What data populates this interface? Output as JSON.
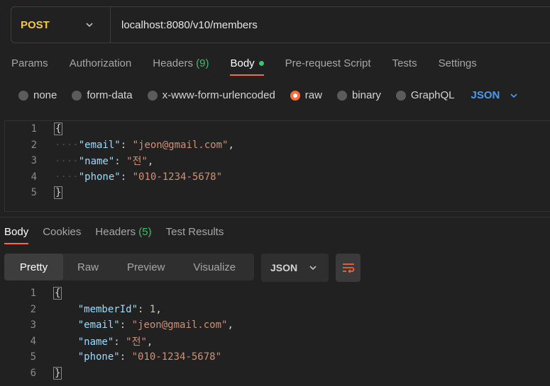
{
  "request": {
    "method": "POST",
    "url": "localhost:8080/v10/members"
  },
  "request_tabs": [
    {
      "label": "Params"
    },
    {
      "label": "Authorization"
    },
    {
      "label": "Headers",
      "count": "(9)"
    },
    {
      "label": "Body",
      "active": true
    },
    {
      "label": "Pre-request Script"
    },
    {
      "label": "Tests"
    },
    {
      "label": "Settings"
    }
  ],
  "body_types": {
    "none": "none",
    "form_data": "form-data",
    "urlencoded": "x-www-form-urlencoded",
    "raw": "raw",
    "binary": "binary",
    "graphql": "GraphQL",
    "language": "JSON",
    "selected": "raw"
  },
  "request_body": {
    "line_numbers": [
      "1",
      "2",
      "3",
      "4",
      "5"
    ],
    "open_brace": "{",
    "close_brace": "}",
    "fields": [
      {
        "key": "\"email\"",
        "value": "\"jeon@gmail.com\"",
        "sep": ": ",
        "end": ","
      },
      {
        "key": "\"name\"",
        "value": "\"전\"",
        "sep": ": ",
        "end": ","
      },
      {
        "key": "\"phone\"",
        "value": "\"010-1234-5678\"",
        "sep": ": ",
        "end": ""
      }
    ],
    "indent": "····"
  },
  "response_tabs": {
    "body": "Body",
    "cookies": "Cookies",
    "headers": "Headers",
    "headers_count": "(5)",
    "test_results": "Test Results"
  },
  "response_view": {
    "pretty": "Pretty",
    "raw": "Raw",
    "preview": "Preview",
    "visualize": "Visualize",
    "format": "JSON"
  },
  "response_body": {
    "line_numbers": [
      "1",
      "2",
      "3",
      "4",
      "5",
      "6"
    ],
    "open_brace": "{",
    "close_brace": "}",
    "fields": [
      {
        "key": "\"memberId\"",
        "value": "1",
        "sep": ": ",
        "end": ","
      },
      {
        "key": "\"email\"",
        "value": "\"jeon@gmail.com\"",
        "sep": ": ",
        "end": ","
      },
      {
        "key": "\"name\"",
        "value": "\"전\"",
        "sep": ": ",
        "end": ","
      },
      {
        "key": "\"phone\"",
        "value": "\"010-1234-5678\"",
        "sep": ": ",
        "end": ""
      }
    ]
  },
  "colors": {
    "accent": "#ff6c37",
    "method": "#f2c94c",
    "count": "#3fbf6f",
    "language": "#4a9bf0"
  }
}
